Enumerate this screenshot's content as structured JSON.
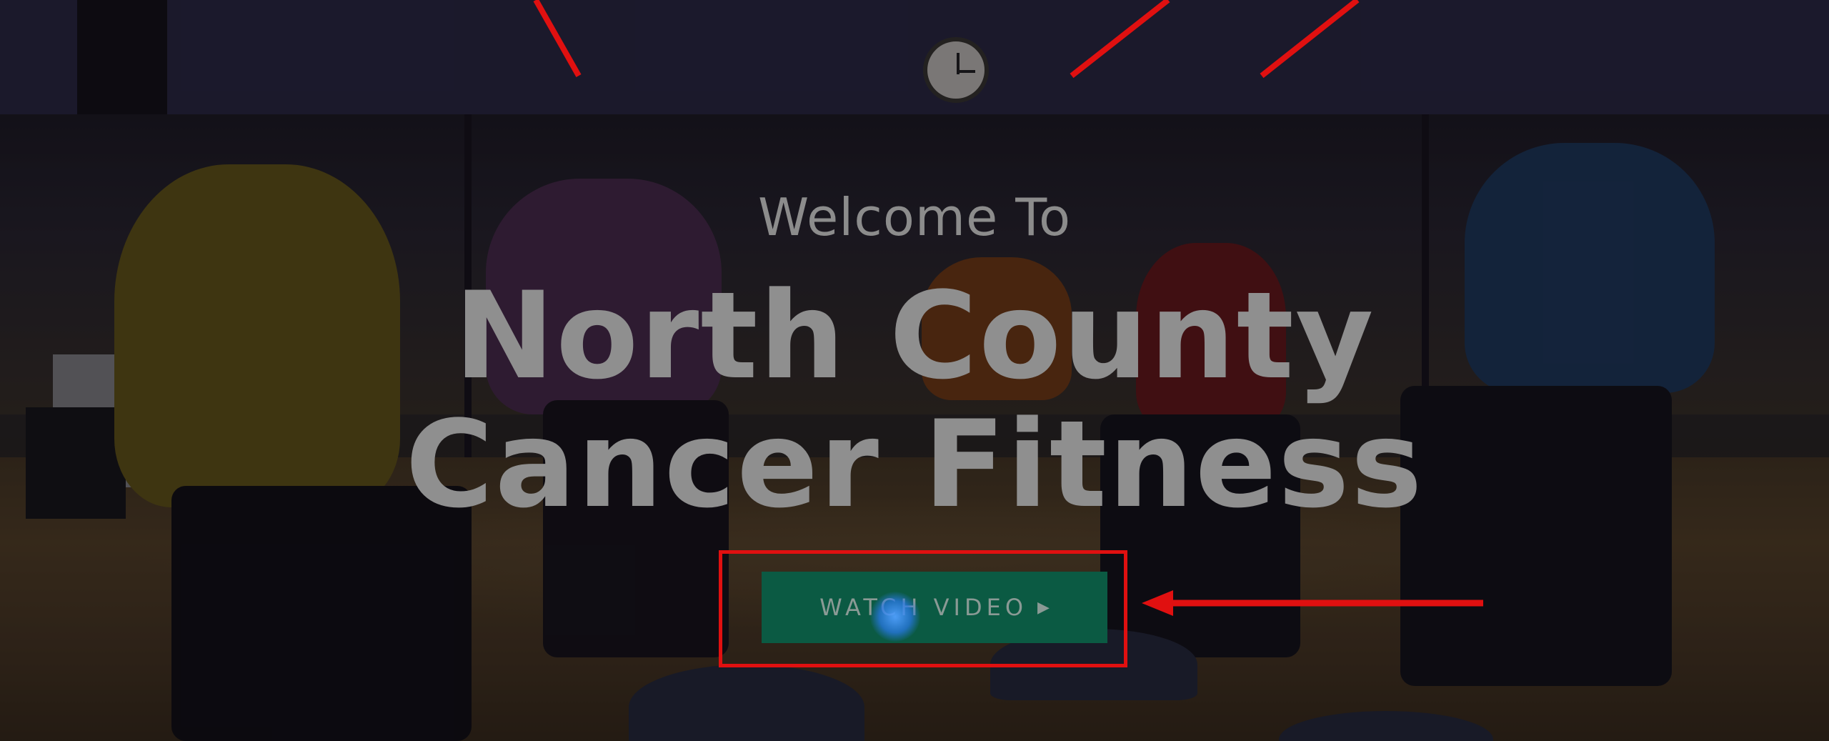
{
  "hero": {
    "welcome": "Welcome To",
    "title_line1": "North County",
    "title_line2": "Cancer Fitness"
  },
  "cta": {
    "watch_video_label": "WATCH VIDEO",
    "play_icon": "▶"
  },
  "colors": {
    "button_bg": "#0b5a43",
    "annotation_red": "#e01010",
    "click_indicator": "#3a8cf0"
  }
}
